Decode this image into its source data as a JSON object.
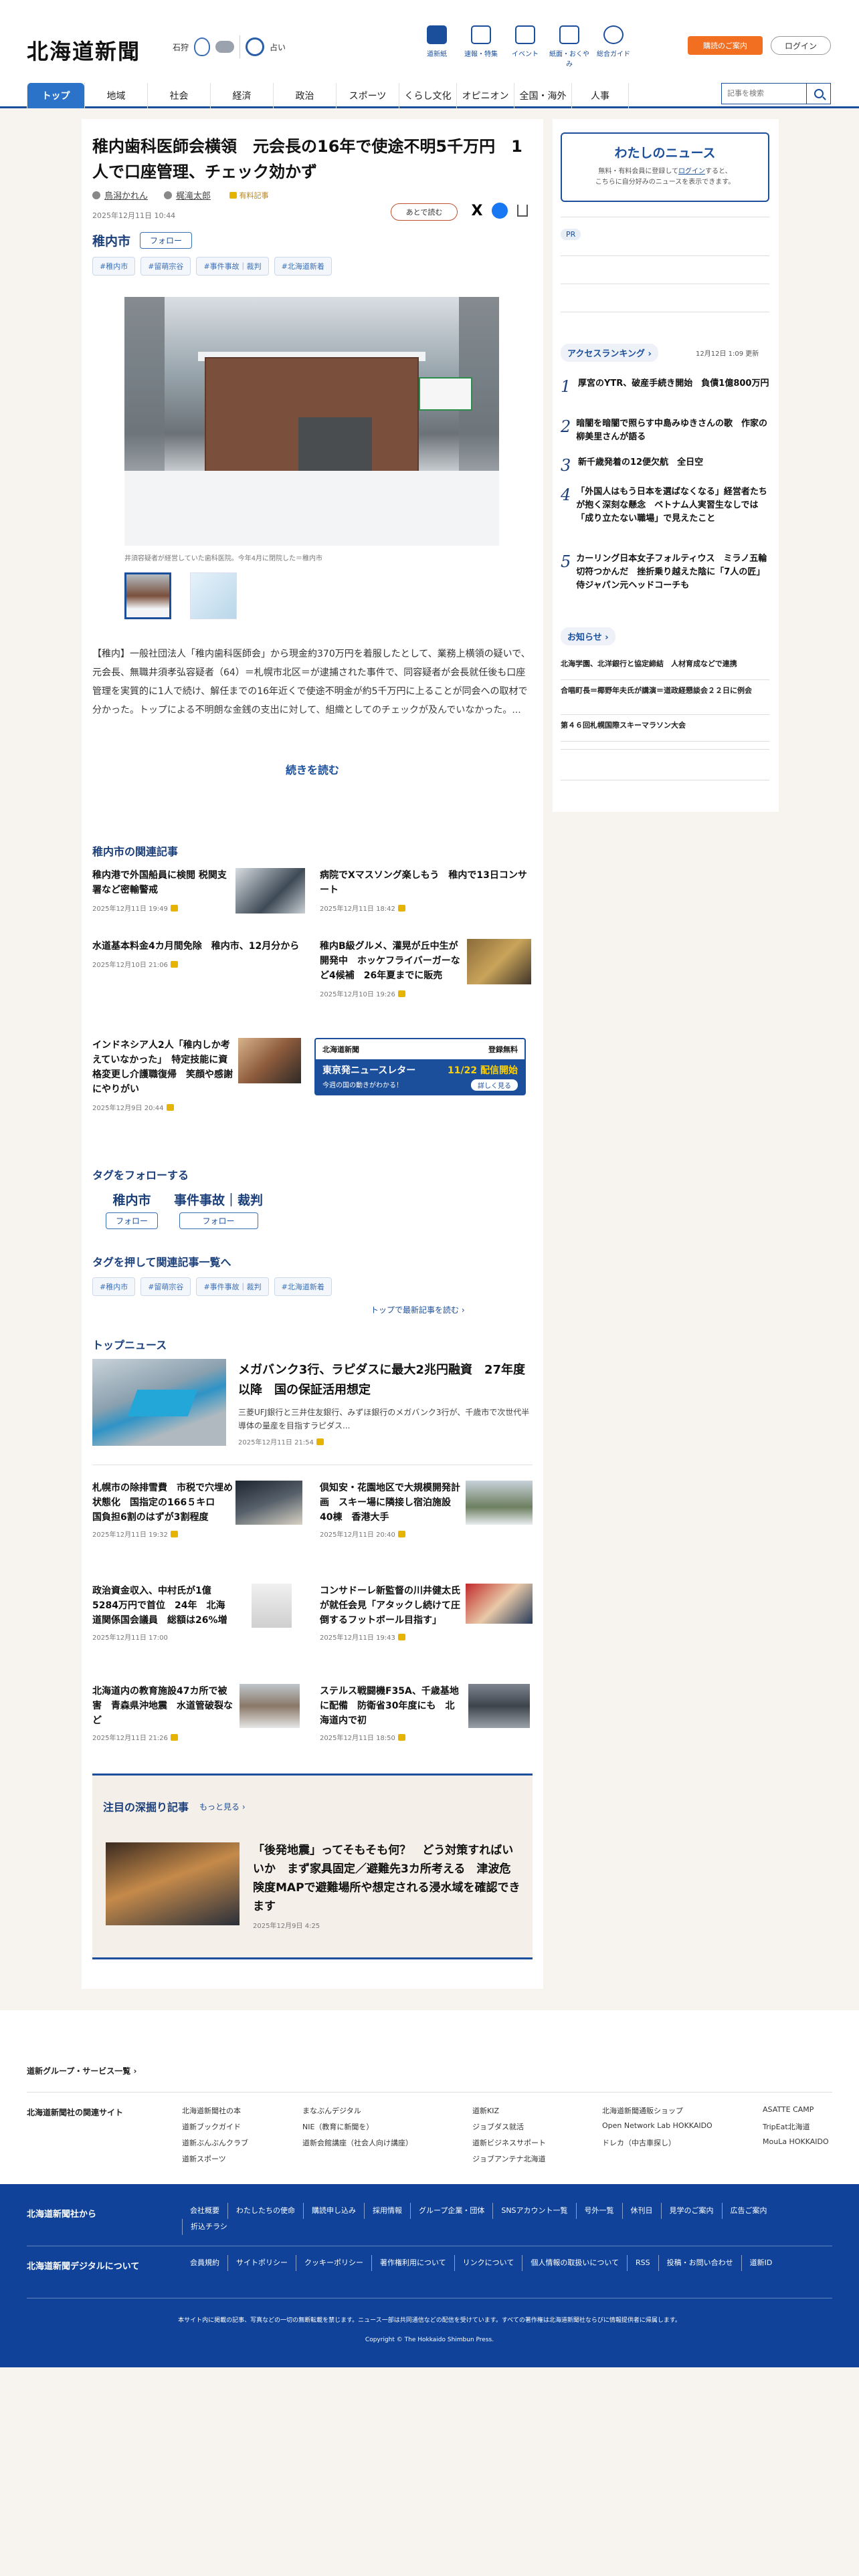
{
  "header": {
    "logo": "北海道新聞",
    "weather": {
      "city": "石狩",
      "temp": "",
      "airing": "占い"
    },
    "icons": [
      {
        "label": "道新紙",
        "icon": "newspaper-icon"
      },
      {
        "label": "速報・特集",
        "icon": "flag-icon"
      },
      {
        "label": "イベント",
        "icon": "calendar-icon"
      },
      {
        "label": "紙面・おくやみ",
        "icon": "paper-icon"
      },
      {
        "label": "総合ガイド",
        "icon": "question-icon"
      }
    ],
    "subscribe": "購読のご案内",
    "login": "ログイン"
  },
  "nav": {
    "items": [
      "トップ",
      "地域",
      "社会",
      "経済",
      "政治",
      "スポーツ",
      "くらし文化",
      "オピニオン",
      "全国・海外",
      "人事"
    ],
    "search_placeholder": "記事を検索"
  },
  "article": {
    "title": "稚内歯科医師会横領　元会長の16年で使途不明5千万円　1人で口座管理、チェック効かず",
    "authors": [
      "鳥潟かれん",
      "梶滝太郎"
    ],
    "author_label": "有料記事",
    "date": "2025年12月11日 10:44",
    "later": "あとで読む",
    "place": "稚内市",
    "follow": "フォロー",
    "tags": [
      "#稚内市",
      "#留萌宗谷",
      "#事件事故｜裁判",
      "#北海道新着"
    ],
    "caption": "井須容疑者が経営していた歯科医院。今年4月に閉院した＝稚内市",
    "body": "【稚内】一般社団法人「稚内歯科医師会」から現金約370万円を着服したとして、業務上横領の疑いで、元会長、無職井須孝弘容疑者（64）＝札幌市北区＝が逮捕された事件で、同容疑者が会長就任後も口座管理を実質的に1人で続け、解任までの16年近くで使途不明金が約5千万円に上ることが同会への取材で分かった。トップによる不明朗な金銭の支出に対して、組織としてのチェックが及んでいなかった。...",
    "readmore": "続きを読む"
  },
  "related": {
    "heading": "稚内市の関連記事",
    "items": [
      {
        "title": "稚内港で外国船員に検閲 税関支署など密輸警戒",
        "date": "2025年12月11日 19:49"
      },
      {
        "title": "病院でXマスソング楽しもう　稚内で13日コンサート",
        "date": "2025年12月11日 18:42"
      },
      {
        "title": "水道基本料金4カ月間免除　稚内市、12月分から",
        "date": "2025年12月10日 21:06"
      },
      {
        "title": "稚内B級グルメ、灌晃が丘中生が開発中　ホッケフライバーガーなど4候補　26年夏までに販売",
        "date": "2025年12月10日 19:26"
      },
      {
        "title": "インドネシア人2人「稚内しか考えていなかった」　特定技能に資格変更し介護職復帰　笑顔や感謝にやりがい",
        "date": "2025年12月9日 20:44"
      }
    ],
    "banner": {
      "brand": "北海道新聞",
      "tag": "登録無料",
      "title": "東京発ニュースレター",
      "date": "11/22 配信開始",
      "sub": "今週の国の動きがわかる！",
      "btn": "詳しく見る"
    }
  },
  "tag_follow": {
    "heading": "タグをフォローする",
    "items": [
      "稚内市",
      "事件事故｜裁判"
    ],
    "follow": "フォロー",
    "heading2": "タグを押して関連記事一覧へ",
    "more": "トップで最新記事を読む"
  },
  "top_news": {
    "heading": "トップニュース",
    "lead_title": "メガバンク3行、ラピダスに最大2兆円融資　27年度以降　国の保証活用想定",
    "lead_body": "三菱UFJ銀行と三井住友銀行、みずほ銀行のメガバンク3行が、千歳市で次世代半導体の量産を目指すラピダス...",
    "lead_date": "2025年12月11日 21:54",
    "items": [
      {
        "title": "札幌市の除排雪費　市税で穴埋め状態化　国指定の166５キロ　国負担6割のはずが3割程度",
        "date": "2025年12月11日 19:32"
      },
      {
        "title": "倶知安・花園地区で大規模開発計画　スキー場に隣接し宿泊施設40棟　香港大手",
        "date": "2025年12月11日 20:40"
      },
      {
        "title": "政治資金収入、中村氏が1億5284万円で首位　24年　北海道関係国会議員　総額は26%増",
        "date": "2025年12月11日 17:00"
      },
      {
        "title": "コンサドーレ新監督の川井健太氏が就任会見「アタックし続けて圧倒するフットボール目指す」",
        "date": "2025年12月11日 19:43"
      },
      {
        "title": "北海道内の教育施設47カ所で被害　青森県沖地震　水道管破裂など",
        "date": "2025年12月11日 21:26"
      },
      {
        "title": "ステルス戦闘機F35A、千歳基地に配備　防衛省30年度にも　北海道内で初",
        "date": "2025年12月11日 18:50"
      }
    ]
  },
  "deep": {
    "heading": "注目の深掘り記事",
    "more": "もっと見る",
    "title": "「後発地震」ってそもそも何？　どう対策すればいいか　まず家具固定／避難先3カ所考える　津波危険度MAPで避難場所や想定される浸水域を確認できます",
    "date": "2025年12月9日 4:25"
  },
  "sidebar": {
    "mynews_title": "わたしのニュース",
    "mynews_text1": "無料・有料会員に登録して",
    "mynews_login": "ログイン",
    "mynews_text2": "すると、",
    "mynews_text3": "こちらに自分好みのニュースを表示できます。",
    "pr": "PR",
    "ranking_h": "アクセスランキング",
    "ranking_date": "12月12日 1:09 更新",
    "ranking": [
      "厚宮のYTR、破産手続き開始　負債1億800万円",
      "暗闇を暗闇で照らす中島みゆきさんの歌　作家の柳美里さんが語る",
      "新千歳発着の12便欠航　全日空",
      "「外国人はもう日本を選ばなくなる」経営者たちが抱く深刻な懸念　ベトナム人実習生なしでは「成り立たない職場」で見えたこと",
      "カーリング日本女子フォルティウス　ミラノ五輪切符つかんだ　挫折乗り越えた陰に「7人の匠」 侍ジャパン元ヘッドコーチも"
    ],
    "notice_h": "お知らせ",
    "notices": [
      "北海学園、北洋銀行と協定締結　人材育成などで連携",
      "合唱町長＝椰野年夫氏が講演＝道政経懇談会２２日に例会",
      "第４６回札幌国際スキーマラソン大会"
    ]
  },
  "footer": {
    "group_h": "道新グループ・サービス一覧",
    "related_h": "北海道新聞社の関連サイト",
    "cols": [
      [
        "北海道新聞社の本",
        "道新ブックガイド",
        "道新ぶんぶんクラブ",
        "道新スポーツ"
      ],
      [
        "まなぶんデジタル",
        "NIE（教育に新聞を）",
        "道新会館講座（社会人向け講座）"
      ],
      [
        "道新KIZ",
        "ジョブダス就活",
        "道新ビジネスサポート",
        "ジョブアンテナ北海道"
      ],
      [
        "北海道新聞通販ショップ",
        "Open Network Lab HOKKAIDO",
        "ドレカ（中古車探し）"
      ],
      [
        "ASATTE CAMP",
        "TripEat北海道",
        "MouLa HOKKAIDO"
      ]
    ],
    "blue_h1": "北海道新聞社から",
    "blue_row1": [
      "会社概要",
      "わたしたちの使命",
      "購読申し込み",
      "採用情報",
      "グループ企業・団体",
      "SNSアカウント一覧",
      "号外一覧",
      "休刊日",
      "見学のご案内",
      "広告ご案内",
      "折込チラシ"
    ],
    "blue_h2": "北海道新聞デジタルについて",
    "blue_row2": [
      "会員規約",
      "サイトポリシー",
      "クッキーポリシー",
      "著作権利用について",
      "リンクについて",
      "個人情報の取扱いについて",
      "RSS",
      "投稿・お問い合わせ",
      "道新ID"
    ],
    "note": "本サイト内に掲載の記事、写真などの一切の無断転載を禁じます。ニュース一部は共同通信などの配信を受けています。すべての著作権は北海道新聞社ならびに情報提供者に帰属します。",
    "copyright": "Copyright © The Hokkaido Shimbun Press."
  },
  "colors": {
    "brand": "#1b4f9c",
    "accent": "#f26f21",
    "footer": "#0f4298"
  }
}
